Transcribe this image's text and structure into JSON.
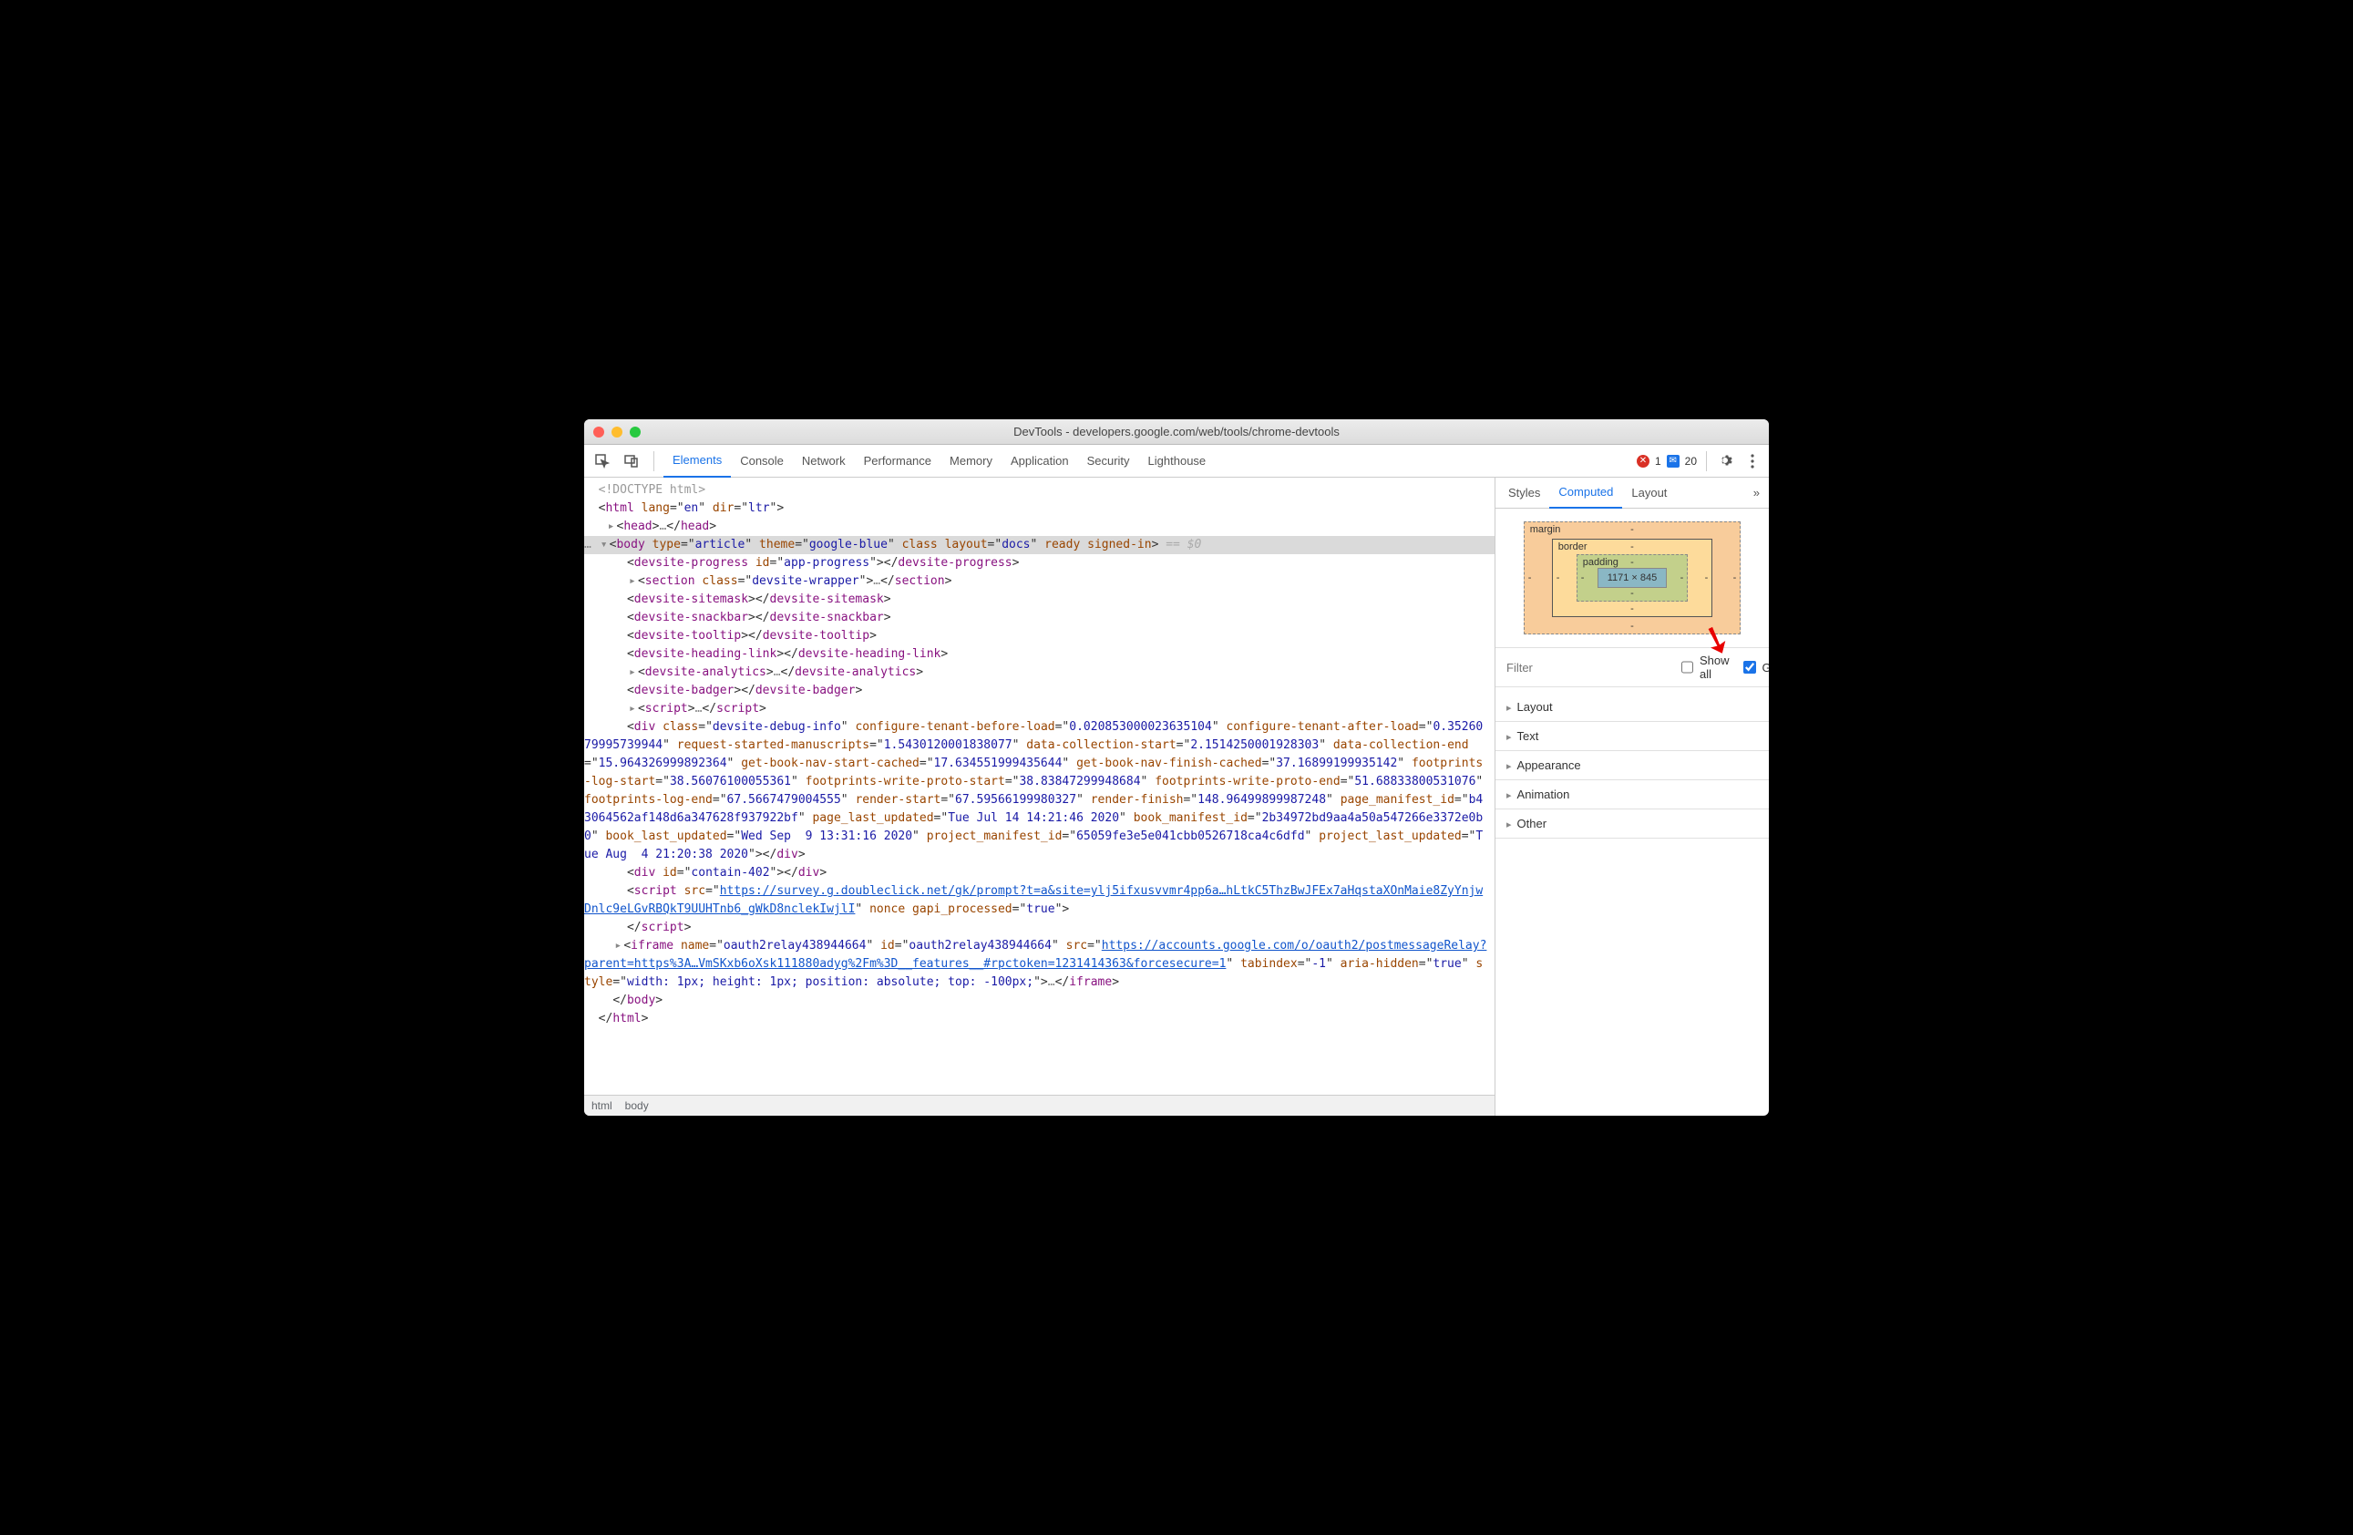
{
  "window": {
    "title": "DevTools - developers.google.com/web/tools/chrome-devtools"
  },
  "toolbar": {
    "tabs": [
      "Elements",
      "Console",
      "Network",
      "Performance",
      "Memory",
      "Application",
      "Security",
      "Lighthouse"
    ],
    "active_tab": "Elements",
    "error_count": "1",
    "message_count": "20"
  },
  "breadcrumbs": [
    "html",
    "body"
  ],
  "side": {
    "tabs": [
      "Styles",
      "Computed",
      "Layout"
    ],
    "active_tab": "Computed",
    "box_model": {
      "margin_label": "margin",
      "border_label": "border",
      "padding_label": "padding",
      "content": "1171 × 845",
      "dash": "-"
    },
    "filter_placeholder": "Filter",
    "show_all_label": "Show all",
    "group_label": "Group",
    "group_checked": true,
    "groups": [
      "Layout",
      "Text",
      "Appearance",
      "Animation",
      "Other"
    ]
  },
  "dom": {
    "doctype": "<!DOCTYPE html>",
    "html_open": {
      "tag": "html",
      "attrs": [
        [
          "lang",
          "en"
        ],
        [
          "dir",
          "ltr"
        ]
      ]
    },
    "head": "<head>…</head>",
    "body_open": {
      "tag": "body",
      "attrs": [
        [
          "type",
          "article"
        ],
        [
          "theme",
          "google-blue"
        ]
      ],
      "bare_attrs": [
        "class"
      ],
      "kv2": [
        [
          "layout",
          "docs"
        ]
      ],
      "bare2": [
        "ready",
        "signed-in"
      ],
      "after": " == $0"
    },
    "children": [
      {
        "t": "tag",
        "tag": "devsite-progress",
        "attrs": [
          [
            "id",
            "app-progress"
          ]
        ],
        "close": "devsite-progress"
      },
      {
        "t": "exp",
        "tag": "section",
        "attrs": [
          [
            "class",
            "devsite-wrapper"
          ]
        ],
        "ell": "…",
        "close": "section"
      },
      {
        "t": "tag",
        "tag": "devsite-sitemask",
        "close": "devsite-sitemask"
      },
      {
        "t": "tag",
        "tag": "devsite-snackbar",
        "close": "devsite-snackbar"
      },
      {
        "t": "tag",
        "tag": "devsite-tooltip",
        "close": "devsite-tooltip"
      },
      {
        "t": "tag",
        "tag": "devsite-heading-link",
        "close": "devsite-heading-link"
      },
      {
        "t": "exp",
        "tag": "devsite-analytics",
        "ell": "…",
        "close": "devsite-analytics"
      },
      {
        "t": "tag",
        "tag": "devsite-badger",
        "close": "devsite-badger"
      },
      {
        "t": "exp",
        "tag": "script",
        "ell": "…",
        "close": "script"
      }
    ],
    "debug_div_attrs": [
      [
        "class",
        "devsite-debug-info"
      ],
      [
        "configure-tenant-before-load",
        "0.020853000023635104"
      ],
      [
        "configure-tenant-after-load",
        "0.3526079995739944"
      ],
      [
        "request-started-manuscripts",
        "1.5430120001838077"
      ],
      [
        "data-collection-start",
        "2.1514250001928303"
      ],
      [
        "data-collection-end",
        "15.964326999892364"
      ],
      [
        "get-book-nav-start-cached",
        "17.634551999435644"
      ],
      [
        "get-book-nav-finish-cached",
        "37.16899199935142"
      ],
      [
        "footprints-log-start",
        "38.56076100055361"
      ],
      [
        "footprints-write-proto-start",
        "38.83847299948684"
      ],
      [
        "footprints-write-proto-end",
        "51.68833800531076"
      ],
      [
        "footprints-log-end",
        "67.5667479004555"
      ],
      [
        "render-start",
        "67.59566199980327"
      ],
      [
        "render-finish",
        "148.96499899987248"
      ],
      [
        "page_manifest_id",
        "b43064562af148d6a347628f937922bf"
      ],
      [
        "page_last_updated",
        "Tue Jul 14 14:21:46 2020"
      ],
      [
        "book_manifest_id",
        "2b34972bd9aa4a50a547266e3372e0b0"
      ],
      [
        "book_last_updated",
        "Wed Sep  9 13:31:16 2020"
      ],
      [
        "project_manifest_id",
        "65059fe3e5e041cbb0526718ca4c6dfd"
      ],
      [
        "project_last_updated",
        "Tue Aug  4 21:20:38 2020"
      ]
    ],
    "contain_div": {
      "tag": "div",
      "attrs": [
        [
          "id",
          "contain-402"
        ]
      ]
    },
    "script_src": "https://survey.g.doubleclick.net/gk/prompt?t=a&site=ylj5ifxusvvmr4pp6a…hLtkC5ThzBwJFEx7aHqstaXOnMaie8ZyYnjwDnlc9eLGvRBQkT9UUHTnb6_gWkD8nclekIwjlI",
    "script_after_attrs": [
      [
        "nonce",
        ""
      ],
      [
        "",
        "gapi_processed=\"true\""
      ]
    ],
    "script_after_text": " nonce gapi_processed=\"true\">",
    "iframe_attrs": [
      [
        "name",
        "oauth2relay438944664"
      ],
      [
        "id",
        "oauth2relay438944664"
      ]
    ],
    "iframe_src": "https://accounts.google.com/o/oauth2/postmessageRelay?parent=https%3A…VmSKxb6oXsk111880adyg%2Fm%3D__features__#rpctoken=1231414363&forcesecure=1",
    "iframe_after": " tabindex=\"-1\" aria-hidden=\"true\" style=\"width: 1px; height: 1px; position: absolute; top: -100px;\">…</iframe>",
    "body_close": "</body>",
    "html_close": "</html>"
  }
}
